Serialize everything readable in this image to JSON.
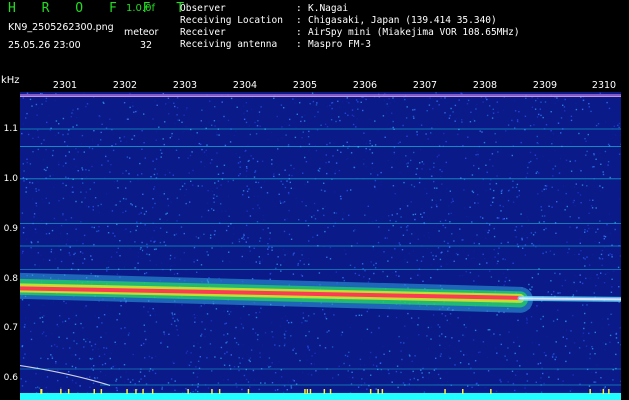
{
  "header": {
    "app_title": "H R O F F T",
    "version": "1.0.0f",
    "filename": "KN9_2505262300.png",
    "meteor_label": "meteor",
    "datetime": "25.05.26 23:00",
    "meteor_count": "32"
  },
  "info": {
    "rows": [
      {
        "key": "Observer",
        "sep": ":",
        "value": "K.Nagai"
      },
      {
        "key": "Receiving Location",
        "sep": ":",
        "value": "Chigasaki, Japan (139.414 35.340)"
      },
      {
        "key": "Receiver",
        "sep": ":",
        "value": "AirSpy mini (Miakejima VOR 108.65MHz)"
      },
      {
        "key": "Receiving antenna",
        "sep": ":",
        "value": "Maspro FM-3"
      }
    ]
  },
  "axis": {
    "unit": "kHz",
    "y_ticks": [
      "1.1",
      "1.0",
      "0.9",
      "0.8",
      "0.7",
      "0.6"
    ],
    "y_values": [
      1.1,
      1.0,
      0.9,
      0.8,
      0.7,
      0.6
    ],
    "time_labels": [
      "2301",
      "2302",
      "2303",
      "2304",
      "2305",
      "2306",
      "2307",
      "2308",
      "2309",
      "2310"
    ]
  },
  "colors": {
    "title_green": "#22dd22",
    "background_noise": "#0a1a88",
    "signal_red": "#ff3355",
    "signal_yellow": "#e8e820",
    "signal_green": "#22dd55",
    "cyan": "#22ffff"
  }
}
